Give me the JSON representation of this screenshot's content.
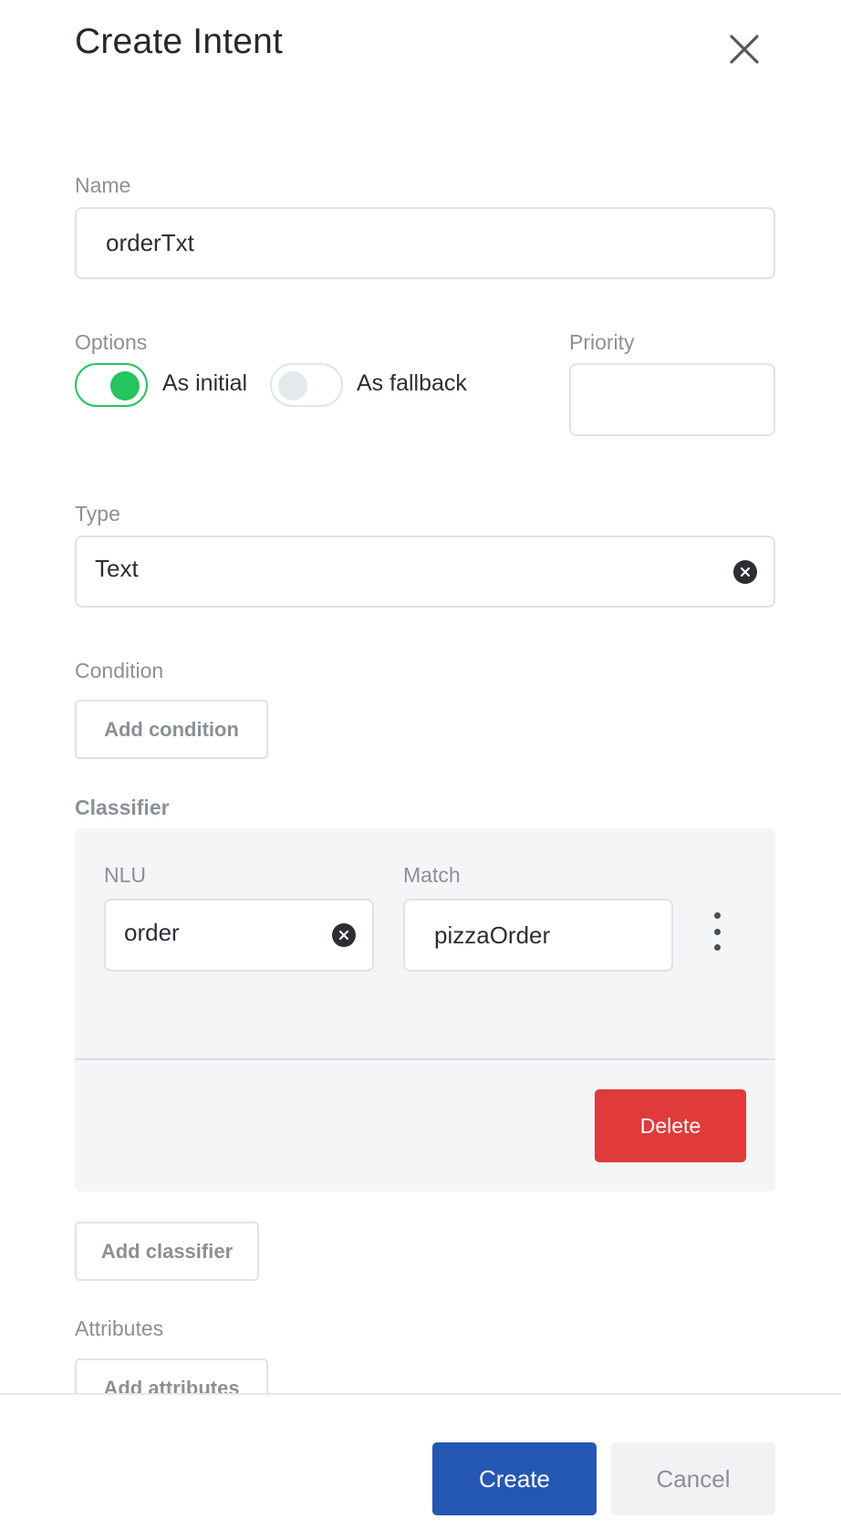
{
  "dialog": {
    "title": "Create Intent"
  },
  "name": {
    "label": "Name",
    "value": "orderTxt"
  },
  "options": {
    "label": "Options",
    "as_initial": {
      "label": "As initial",
      "on": true
    },
    "as_fallback": {
      "label": "As fallback",
      "on": false
    }
  },
  "priority": {
    "label": "Priority",
    "value": ""
  },
  "type": {
    "label": "Type",
    "value": "Text"
  },
  "condition": {
    "label": "Condition",
    "add_label": "Add condition"
  },
  "classifier": {
    "label": "Classifier",
    "nlu_label": "NLU",
    "nlu_value": "order",
    "match_label": "Match",
    "match_value": "pizzaOrder",
    "delete_label": "Delete",
    "add_label": "Add classifier"
  },
  "attributes": {
    "label": "Attributes",
    "add_label": "Add attributes"
  },
  "footer": {
    "create_label": "Create",
    "cancel_label": "Cancel"
  },
  "colors": {
    "accent": "#2456b3",
    "toggle_on": "#22c55e",
    "danger": "#e03a3a"
  }
}
